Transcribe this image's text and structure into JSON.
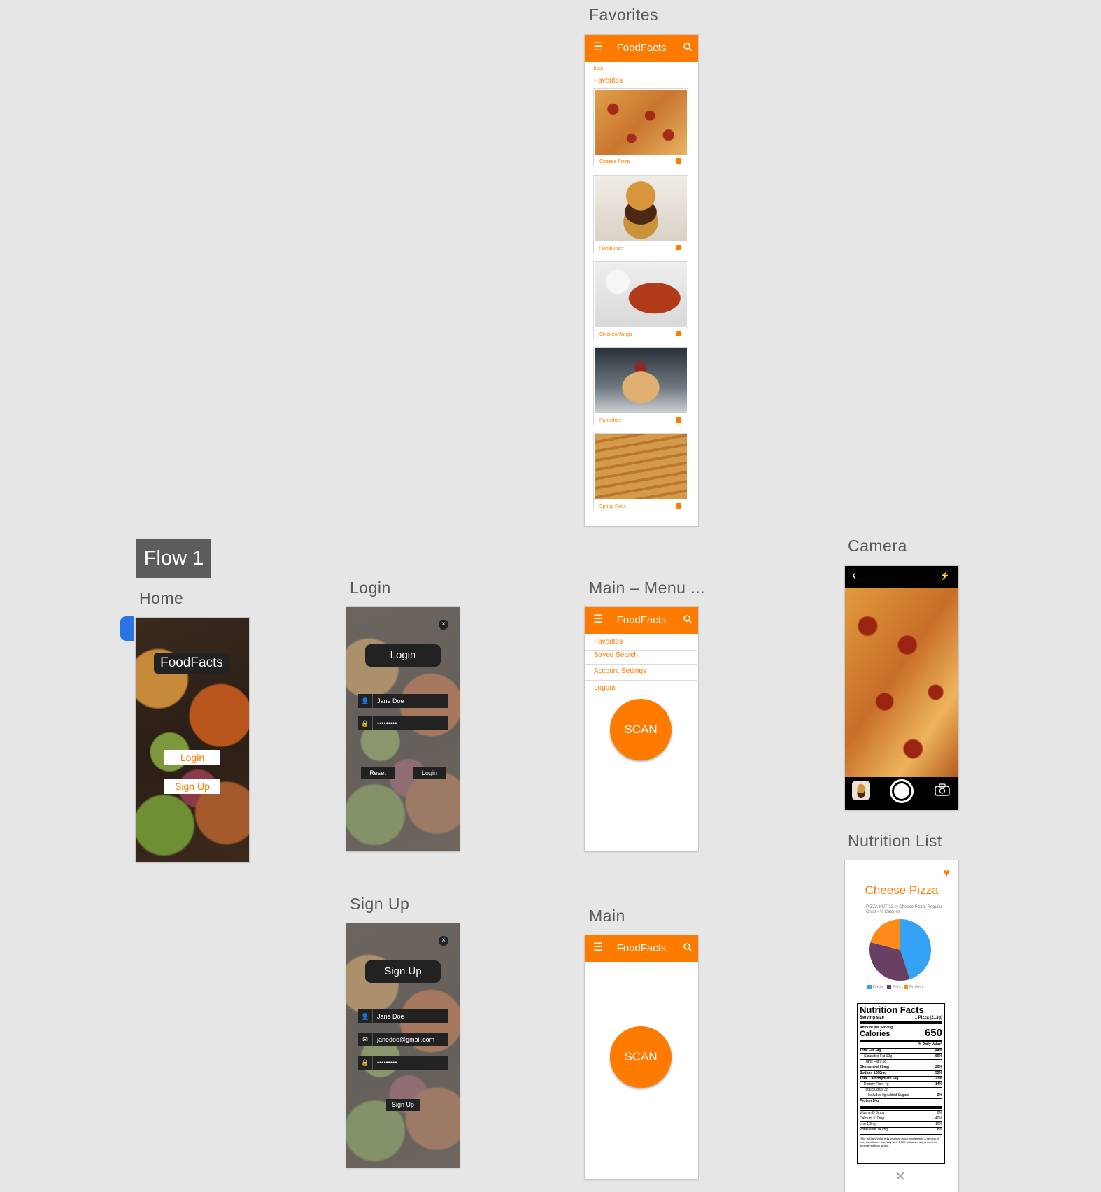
{
  "labels": {
    "favorites": "Favorites",
    "home": "Home",
    "login": "Login",
    "main_menu": "Main – Menu ...",
    "camera": "Camera",
    "nutrition_list": "Nutrition List",
    "sign_up": "Sign Up",
    "main": "Main"
  },
  "flow_tag": "Flow 1",
  "app": {
    "title": "FoodFacts",
    "menu_glyph": "☰",
    "accent": "#ff7b00"
  },
  "home": {
    "title": "FoodFacts",
    "login": "Login",
    "signup": "Sign Up"
  },
  "login_screen": {
    "heading": "Login",
    "username": "Jane Doe",
    "password": "•••••••••",
    "reset": "Reset",
    "login": "Login",
    "close": "×"
  },
  "signup_screen": {
    "heading": "Sign Up",
    "username": "Jane Doe",
    "email": "janedoe@gmail.com",
    "password": "•••••••••",
    "submit": "Sign Up",
    "close": "×"
  },
  "favorites_screen": {
    "back": "‹ Back",
    "heading": "Favorites",
    "items": [
      {
        "name": "Cheese Pizza",
        "icon": "trash-icon"
      },
      {
        "name": "Hamburger",
        "icon": "trash-icon"
      },
      {
        "name": "Chicken Wings",
        "icon": "trash-icon"
      },
      {
        "name": "Pancakes",
        "icon": "trash-icon"
      },
      {
        "name": "Spring Rolls",
        "icon": "trash-icon"
      }
    ]
  },
  "main_menu_screen": {
    "items": [
      "Favorites",
      "Saved Search",
      "Account Settings",
      "Logout"
    ],
    "scan": "SCAN"
  },
  "main_screen": {
    "scan": "SCAN"
  },
  "camera_screen": {
    "back": "‹",
    "flash": "⚡"
  },
  "nutrition_screen": {
    "title": "Cheese Pizza",
    "subtitle": "PIZZA HUT 12-in Cheese Pizza, Regular Crust - % Calories",
    "legend": [
      "Carbs",
      "Fats",
      "Protein"
    ],
    "legend_colors": [
      "#35a3f5",
      "#6a3f66",
      "#ff8a1c"
    ],
    "pie": [
      {
        "name": "Carbs",
        "value": 45
      },
      {
        "name": "Fats",
        "value": 34
      },
      {
        "name": "Protein",
        "value": 21
      }
    ],
    "facts": {
      "header": "Nutrition Facts",
      "serving_label": "Serving size",
      "serving_value": "1 Pizza (213g)",
      "amount_per": "Amount per serving",
      "calories_label": "Calories",
      "calories_value": "650",
      "dv_header": "% Daily Value*",
      "rows": [
        {
          "label": "Total Fat 34g",
          "dv": "44%"
        },
        {
          "label": "Saturated Fat 12g",
          "dv": "60%"
        },
        {
          "label": "Trans Fat 0.5g",
          "dv": ""
        },
        {
          "label": "Cholesterol 60mg",
          "dv": "20%"
        },
        {
          "label": "Sodium 1260mg",
          "dv": "55%"
        },
        {
          "label": "Total Carbohydrate 63g",
          "dv": "23%"
        },
        {
          "label": "Dietary Fiber 4g",
          "dv": "14%"
        },
        {
          "label": "Total Sugars 3g",
          "dv": ""
        },
        {
          "label": "Includes 0g Added Sugars",
          "dv": "0%"
        },
        {
          "label": "Protein 24g",
          "dv": ""
        }
      ],
      "vitamins": [
        {
          "label": "Vitamin D 0mcg",
          "dv": "0%"
        },
        {
          "label": "Calcium 510mg",
          "dv": "40%"
        },
        {
          "label": "Iron 1.9mg",
          "dv": "10%"
        },
        {
          "label": "Potassium 340mg",
          "dv": "8%"
        }
      ],
      "footnote": "*The % Daily Value tells you how much a nutrient in a serving of food contributes to a daily diet. 2,000 calories a day is used for general nutrition advice."
    },
    "close": "×"
  }
}
